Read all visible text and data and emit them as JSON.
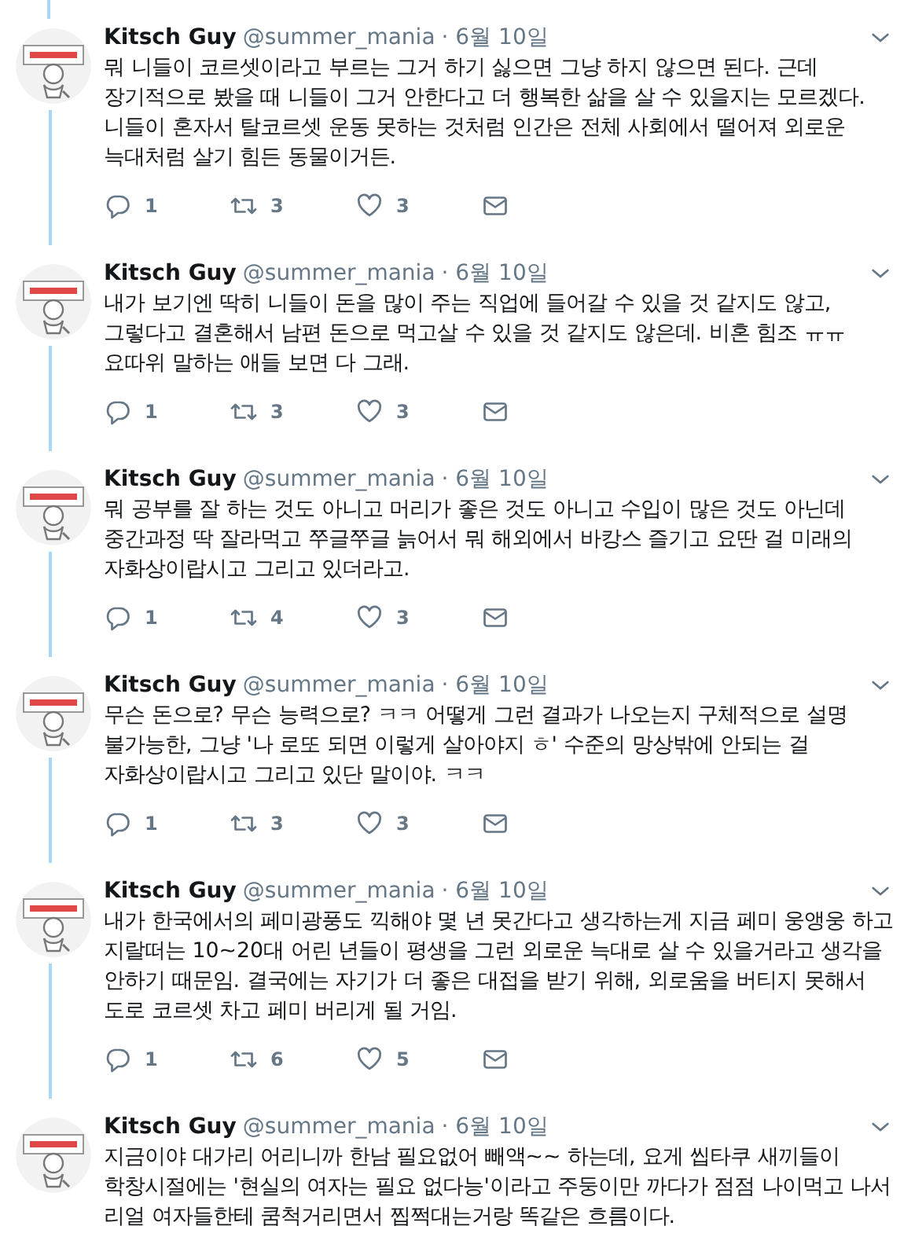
{
  "tweets": [
    {
      "name": "Kitsch Guy",
      "handle": "@summer_mania",
      "date": "· 6월 10일",
      "text": "뭐 니들이 코르셋이라고 부르는 그거 하기 싫으면 그냥 하지 않으면 된다. 근데 장기적으로 봤을 때 니들이 그거 안한다고 더 행복한 삶을 살 수 있을지는 모르겠다. 니들이 혼자서 탈코르셋 운동 못하는 것처럼 인간은 전체 사회에서 떨어져 외로운 늑대처럼 살기 힘든 동물이거든.",
      "replies": "1",
      "retweets": "3",
      "likes": "3"
    },
    {
      "name": "Kitsch Guy",
      "handle": "@summer_mania",
      "date": "· 6월 10일",
      "text": "내가 보기엔 딱히 니들이 돈을 많이 주는 직업에 들어갈 수 있을 것 같지도 않고, 그렇다고 결혼해서 남편 돈으로 먹고살 수 있을 것 같지도 않은데. 비혼 힘조 ㅠㅠ 요따위 말하는 애들 보면 다 그래.",
      "replies": "1",
      "retweets": "3",
      "likes": "3"
    },
    {
      "name": "Kitsch Guy",
      "handle": "@summer_mania",
      "date": "· 6월 10일",
      "text": "뭐 공부를 잘 하는 것도 아니고 머리가 좋은 것도 아니고 수입이 많은 것도 아닌데 중간과정 딱 잘라먹고 쭈글쭈글 늙어서 뭐 해외에서 바캉스 즐기고 요딴 걸 미래의 자화상이랍시고 그리고 있더라고.",
      "replies": "1",
      "retweets": "4",
      "likes": "3"
    },
    {
      "name": "Kitsch Guy",
      "handle": "@summer_mania",
      "date": "· 6월 10일",
      "text": "무슨 돈으로? 무슨 능력으로? ㅋㅋ 어떻게 그런 결과가 나오는지 구체적으로 설명 불가능한, 그냥 '나 로또 되면 이렇게 살아야지 ㅎ' 수준의 망상밖에 안되는 걸 자화상이랍시고 그리고 있단 말이야. ㅋㅋ",
      "replies": "1",
      "retweets": "3",
      "likes": "3"
    },
    {
      "name": "Kitsch Guy",
      "handle": "@summer_mania",
      "date": "· 6월 10일",
      "text": "내가 한국에서의 페미광풍도 끽해야 몇 년 못간다고 생각하는게 지금 페미 웅앵웅 하고 지랄떠는 10~20대 어린 년들이 평생을 그런 외로운 늑대로 살 수 있을거라고 생각을 안하기 때문임.  결국에는 자기가 더 좋은 대접을 받기 위해, 외로움을 버티지 못해서 도로 코르셋 차고 페미 버리게 될 거임.",
      "replies": "1",
      "retweets": "6",
      "likes": "5"
    },
    {
      "name": "Kitsch Guy",
      "handle": "@summer_mania",
      "date": "· 6월 10일",
      "text": "지금이야 대가리 어리니까 한남 필요없어 빼액~~ 하는데, 요게 씹타쿠 새끼들이 학창시절에는 '현실의 여자는 필요 없다능'이라고 주둥이만 까다가 점점 나이먹고 나서 리얼 여자들한테 쿰척거리면서 찝쩍대는거랑 똑같은 흐름이다."
    }
  ]
}
